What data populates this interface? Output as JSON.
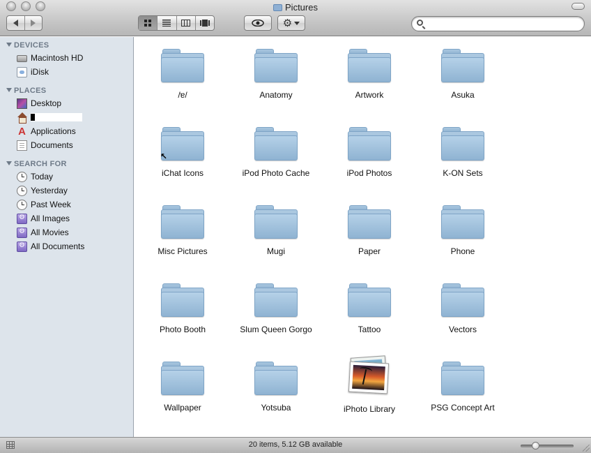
{
  "window": {
    "title": "Pictures"
  },
  "toolbar": {
    "back_label": "Back",
    "forward_label": "Forward",
    "view_modes": [
      "icon",
      "list",
      "column",
      "cover-flow"
    ],
    "active_view": "icon",
    "quick_look_label": "Quick Look",
    "action_label": "Action",
    "search": {
      "value": "",
      "placeholder": ""
    }
  },
  "sidebar": {
    "sections": [
      {
        "heading": "DEVICES",
        "items": [
          {
            "label": "Macintosh HD",
            "icon": "hard-drive-icon"
          },
          {
            "label": "iDisk",
            "icon": "idisk-icon"
          }
        ]
      },
      {
        "heading": "PLACES",
        "items": [
          {
            "label": "Desktop",
            "icon": "desktop-icon"
          },
          {
            "label": "",
            "icon": "home-icon",
            "redacted": true
          },
          {
            "label": "Applications",
            "icon": "applications-icon"
          },
          {
            "label": "Documents",
            "icon": "documents-icon"
          }
        ]
      },
      {
        "heading": "SEARCH FOR",
        "items": [
          {
            "label": "Today",
            "icon": "clock-icon"
          },
          {
            "label": "Yesterday",
            "icon": "clock-icon"
          },
          {
            "label": "Past Week",
            "icon": "clock-icon"
          },
          {
            "label": "All Images",
            "icon": "smart-folder-icon"
          },
          {
            "label": "All Movies",
            "icon": "smart-folder-icon"
          },
          {
            "label": "All Documents",
            "icon": "smart-folder-icon"
          }
        ]
      }
    ]
  },
  "items": [
    {
      "name": "/ɐ/",
      "type": "folder"
    },
    {
      "name": "Anatomy",
      "type": "folder"
    },
    {
      "name": "Artwork",
      "type": "folder"
    },
    {
      "name": "Asuka",
      "type": "folder"
    },
    {
      "name": "iChat Icons",
      "type": "folder-alias"
    },
    {
      "name": "iPod Photo Cache",
      "type": "folder"
    },
    {
      "name": "iPod Photos",
      "type": "folder"
    },
    {
      "name": "K-ON Sets",
      "type": "folder"
    },
    {
      "name": "Misc Pictures",
      "type": "folder"
    },
    {
      "name": "Mugi",
      "type": "folder"
    },
    {
      "name": "Paper",
      "type": "folder"
    },
    {
      "name": "Phone",
      "type": "folder"
    },
    {
      "name": "Photo Booth",
      "type": "folder"
    },
    {
      "name": "Slum Queen Gorgo",
      "type": "folder"
    },
    {
      "name": "Tattoo",
      "type": "folder"
    },
    {
      "name": "Vectors",
      "type": "folder"
    },
    {
      "name": "Wallpaper",
      "type": "folder"
    },
    {
      "name": "Yotsuba",
      "type": "folder"
    },
    {
      "name": "iPhoto Library",
      "type": "iphoto-library"
    },
    {
      "name": "PSG Concept Art",
      "type": "folder"
    }
  ],
  "status": {
    "text": "20 items, 5.12 GB available",
    "icon_size_level": 0.25
  },
  "colors": {
    "sidebar_bg": "#dde4eb",
    "sidebar_heading": "#6e7a88",
    "folder_blue": "#93b6d4"
  }
}
